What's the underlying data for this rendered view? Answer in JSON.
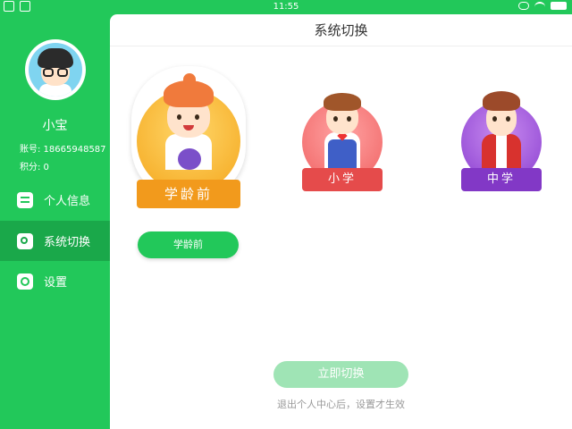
{
  "statusbar": {
    "time": "11:55"
  },
  "sidebar": {
    "username": "小宝",
    "account": "账号: 18665948587",
    "points": "积分: 0",
    "items": [
      {
        "label": "个人信息",
        "icon": "list-icon"
      },
      {
        "label": "系统切换",
        "icon": "switch-icon"
      },
      {
        "label": "设置",
        "icon": "gear-icon"
      }
    ]
  },
  "main": {
    "title": "系统切换",
    "options": [
      {
        "label": "学龄前",
        "color": "#f29a1c"
      },
      {
        "label": "小学",
        "color": "#e54b4b"
      },
      {
        "label": "中学",
        "color": "#8238c6"
      }
    ],
    "selected_label": "学龄前",
    "switch_button": "立即切换",
    "hint": "退出个人中心后，设置才生效"
  },
  "colors": {
    "accent": "#22c85a",
    "accent_dark": "#1aa84a"
  }
}
